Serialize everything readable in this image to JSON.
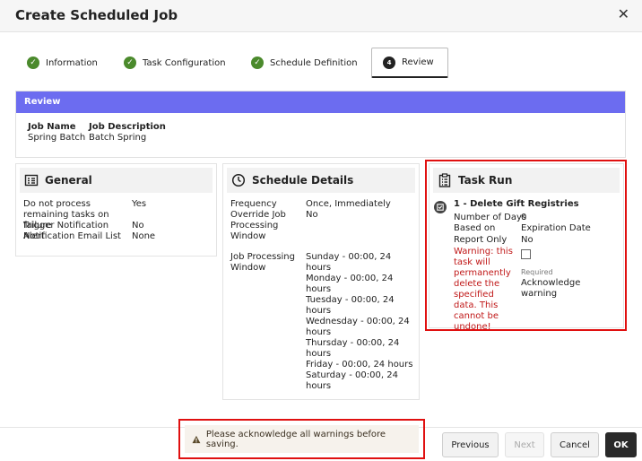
{
  "dialog": {
    "title": "Create Scheduled Job"
  },
  "steps": [
    {
      "label": "Information",
      "status": "complete"
    },
    {
      "label": "Task Configuration",
      "status": "complete"
    },
    {
      "label": "Schedule Definition",
      "status": "complete"
    },
    {
      "label": "Review",
      "number": "4",
      "status": "active"
    }
  ],
  "review": {
    "header": "Review",
    "job_name_label": "Job Name",
    "job_description_label": "Job Description",
    "job_name": "Spring Batch",
    "job_description": "Batch Spring"
  },
  "general": {
    "title": "General",
    "rows": [
      {
        "label": "Do not process remaining tasks on failure",
        "value": "Yes"
      },
      {
        "label": "Trigger Notification Alert",
        "value": "No"
      },
      {
        "label": "Notification Email List",
        "value": "None"
      }
    ]
  },
  "schedule": {
    "title": "Schedule Details",
    "frequency_label": "Frequency",
    "frequency_value": "Once, Immediately",
    "override_label": "Override Job Processing Window",
    "override_value": "No",
    "window_label": "Job Processing Window",
    "window_values": [
      "Sunday - 00:00, 24 hours",
      "Monday - 00:00, 24 hours",
      "Tuesday - 00:00, 24 hours",
      "Wednesday - 00:00, 24 hours",
      "Thursday - 00:00, 24 hours",
      "Friday - 00:00, 24 hours",
      "Saturday - 00:00, 24 hours"
    ]
  },
  "task_run": {
    "title": "Task Run",
    "task_title": "1 - Delete Gift Registries",
    "number_of_days_label": "Number of Days",
    "number_of_days_value": "0",
    "based_on_label": "Based on",
    "based_on_value": "Expiration Date",
    "report_only_label": "Report Only",
    "report_only_value": "No",
    "warning_text": "Warning: this task will permanently delete the specified data. This cannot be undone!",
    "required_label": "Required",
    "acknowledge_label": "Acknowledge warning"
  },
  "footer": {
    "message": "Please acknowledge all warnings before saving.",
    "previous_label": "Previous",
    "next_label": "Next",
    "cancel_label": "Cancel",
    "ok_label": "OK"
  },
  "colors": {
    "review_bar": "#6c6cf0",
    "check": "#4b8a2c",
    "warning_text": "#c01818",
    "highlight": "#e01010"
  }
}
